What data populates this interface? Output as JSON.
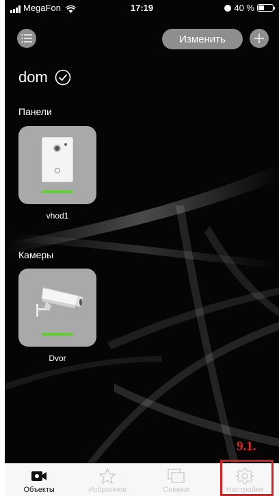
{
  "status_bar": {
    "carrier": "MegaFon",
    "time": "17:19",
    "battery": "40 %",
    "battery_level": 0.4
  },
  "header": {
    "menu_icon": "list-icon",
    "edit_label": "Изменить",
    "add_icon": "plus-icon"
  },
  "home": {
    "name": "dom",
    "status_icon": "check-circle-icon"
  },
  "sections": {
    "panels_title": "Панели",
    "cameras_title": "Камеры"
  },
  "panels": [
    {
      "name": "vhod1",
      "status_color": "#5ed12e"
    }
  ],
  "cameras": [
    {
      "name": "Dvor",
      "status_color": "#5ed12e"
    }
  ],
  "annotation": "9.1.",
  "tabbar": {
    "tabs": [
      {
        "label": "Объекты",
        "icon": "camera-icon",
        "active": true
      },
      {
        "label": "Избранное",
        "icon": "star-icon",
        "active": false
      },
      {
        "label": "Снимки",
        "icon": "gallery-icon",
        "active": false
      },
      {
        "label": "Настройки",
        "icon": "gear-icon",
        "active": false
      }
    ]
  },
  "colors": {
    "accent_green": "#5ed12e",
    "highlight_red": "#e01b1b",
    "button_grey": "#8e8e8e"
  }
}
